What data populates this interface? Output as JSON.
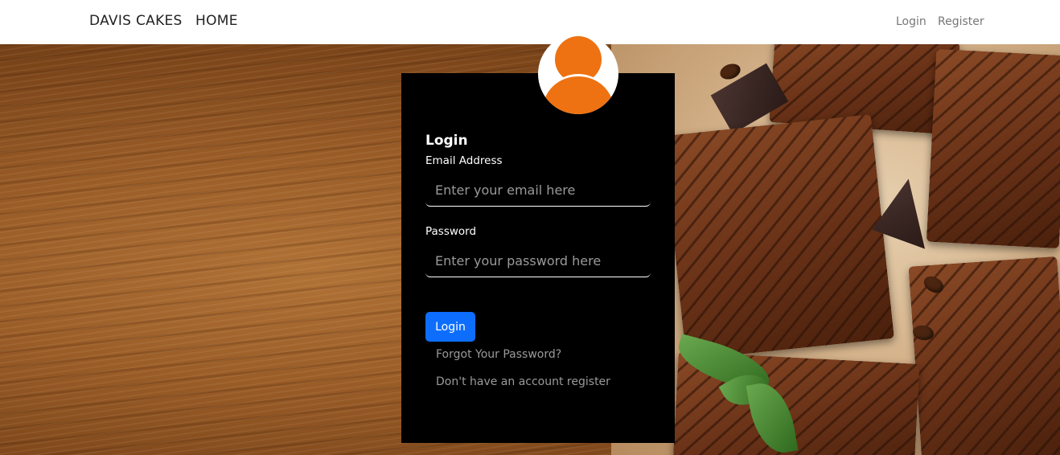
{
  "navbar": {
    "brand": "DAVIS CAKES",
    "home": "HOME",
    "login": "Login",
    "register": "Register"
  },
  "login_card": {
    "title": "Login",
    "email_label": "Email Address",
    "email_placeholder": "Enter your email here",
    "password_label": "Password",
    "password_placeholder": "Enter your password here",
    "submit_label": "Login",
    "forgot_link": "Forgot Your Password?",
    "register_link": "Don't have an account register"
  },
  "icons": {
    "avatar": "user-avatar-icon"
  },
  "colors": {
    "avatar": "#ee7211",
    "primary_button": "#0d6efd",
    "card_background": "#000000"
  }
}
